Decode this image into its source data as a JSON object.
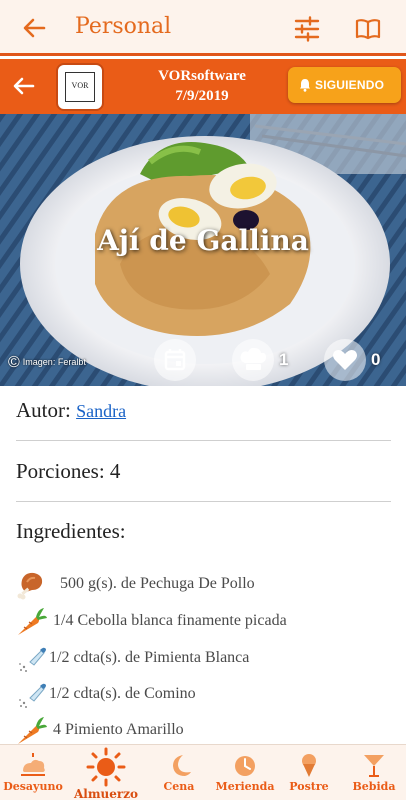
{
  "topbar": {
    "title": "Personal"
  },
  "header": {
    "logo_text": "VOR",
    "author": "VORsoftware",
    "date": "7/9/2019",
    "follow_label": "SIGUIENDO"
  },
  "hero": {
    "dish_title": "Ají de Gallina",
    "credit": "Imagen: Feralbt",
    "cook_count": "1",
    "like_count": "0"
  },
  "details": {
    "author_label": "Autor:",
    "author_name": "Sandra",
    "portions": "Porciones: 4",
    "ingredients_heading": "Ingredientes:"
  },
  "ingredients": [
    {
      "icon": "chicken-leg-icon",
      "text": "500 g(s). de Pechuga De Pollo"
    },
    {
      "icon": "carrot-icon",
      "text": "1/4 Cebolla blanca finamente picada"
    },
    {
      "icon": "salt-shaker-icon",
      "text": "1/2 cdta(s). de Pimienta Blanca"
    },
    {
      "icon": "salt-shaker-icon",
      "text": "1/2 cdta(s). de Comino"
    },
    {
      "icon": "carrot-icon",
      "text": "4 Pimiento Amarillo"
    }
  ],
  "nav": [
    {
      "label": "Desayuno",
      "icon": "sunrise-icon"
    },
    {
      "label": "Almuerzo",
      "icon": "sun-icon",
      "active": true
    },
    {
      "label": "Cena",
      "icon": "moon-icon"
    },
    {
      "label": "Merienda",
      "icon": "clock-icon"
    },
    {
      "label": "Postre",
      "icon": "ice-cream-icon"
    },
    {
      "label": "Bebida",
      "icon": "cocktail-icon"
    }
  ],
  "colors": {
    "accent": "#ea5c17",
    "follow": "#f7a21a",
    "topbar_bg": "#fdf3ec",
    "link": "#1a63c7"
  }
}
